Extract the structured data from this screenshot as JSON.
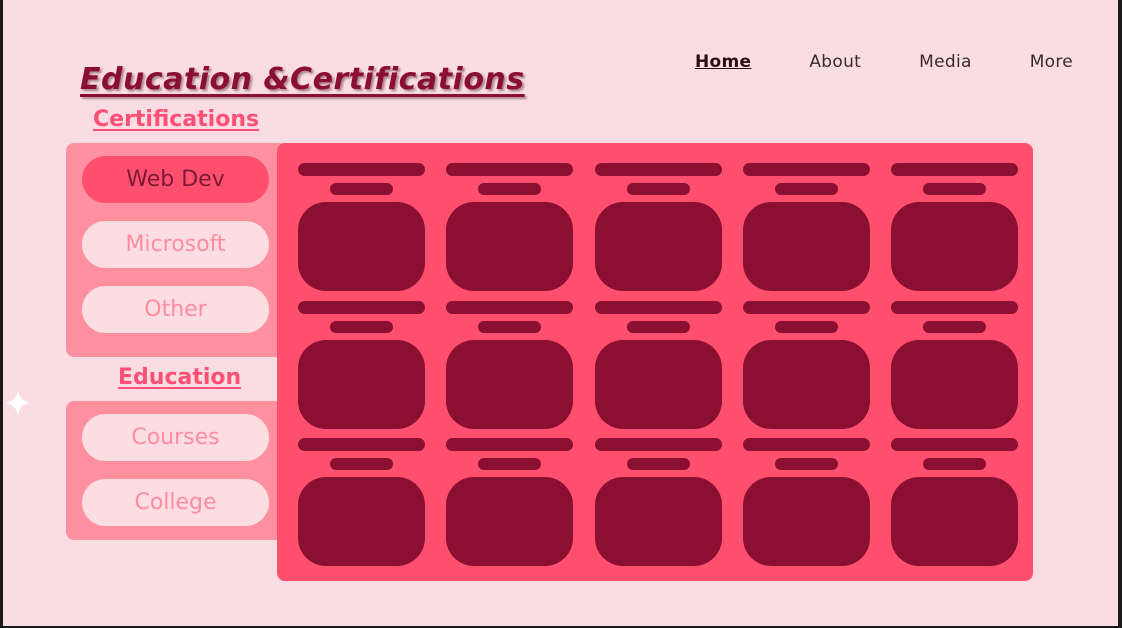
{
  "nav": {
    "items": [
      {
        "label": "Home",
        "active": true
      },
      {
        "label": "About",
        "active": false
      },
      {
        "label": "Media",
        "active": false
      },
      {
        "label": "More",
        "active": false
      }
    ]
  },
  "page_title": "Education &Certifications",
  "certifications": {
    "heading": "Certifications",
    "buttons": [
      {
        "label": "Web Dev",
        "active": true
      },
      {
        "label": "Microsoft",
        "active": false
      },
      {
        "label": "Other",
        "active": false
      }
    ]
  },
  "education": {
    "heading": "Education",
    "buttons": [
      {
        "label": "Courses",
        "active": false
      },
      {
        "label": "College",
        "active": false
      }
    ]
  },
  "grid": {
    "rows": 3,
    "cols": 5
  },
  "colors": {
    "background": "#fadde2",
    "accent": "#ff4f6f",
    "card": "#8b0f30",
    "panel": "#ff909f",
    "button": "#fcdde2"
  },
  "icons": {
    "decoration": "sparkle-icon"
  }
}
